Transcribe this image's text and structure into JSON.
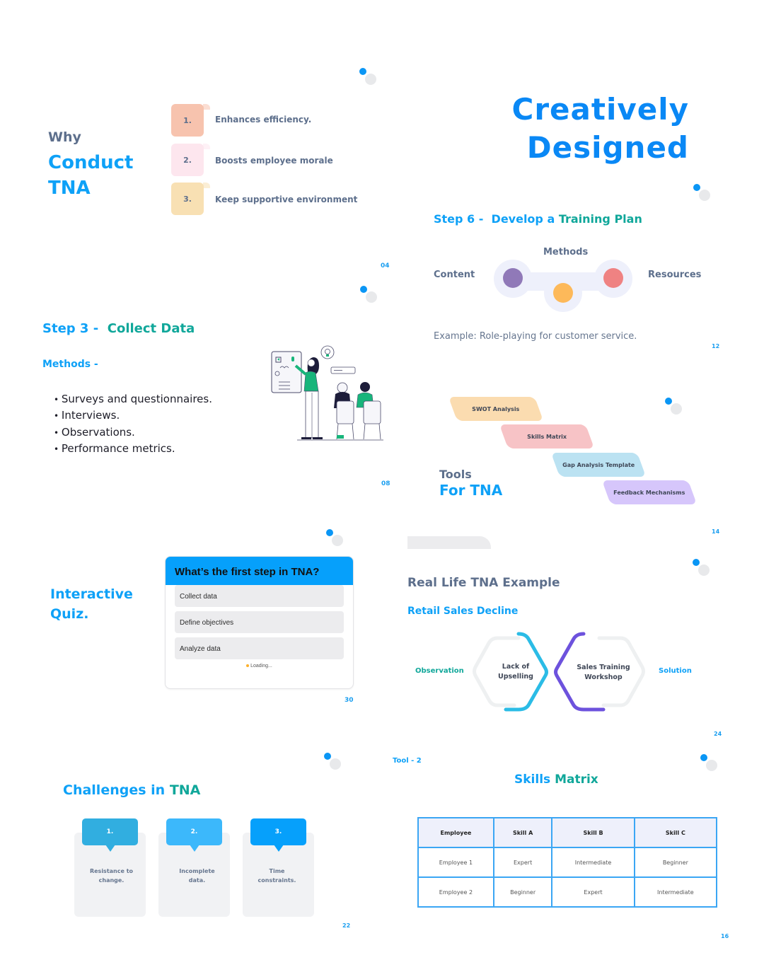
{
  "slides": {
    "why_conduct": {
      "title_line1": "Why",
      "title_line2": "Conduct",
      "title_line3": "TNA",
      "items": [
        {
          "num": "1.",
          "text": "Enhances efficiency.",
          "color": "#f7c3ae"
        },
        {
          "num": "2.",
          "text": "Boosts employee morale",
          "color": "#fde6ee"
        },
        {
          "num": "3.",
          "text": "Keep supportive environment",
          "color": "#f8e0b3"
        }
      ],
      "page": "04"
    },
    "creative": {
      "line1": "Creatively",
      "line2": "Designed"
    },
    "step6": {
      "prefix": "Step 6 -",
      "title_a": "Develop a",
      "title_b": "Training Plan",
      "labels": {
        "content": "Content",
        "methods": "Methods",
        "resources": "Resources"
      },
      "dot_colors": {
        "content": "#9079b8",
        "methods": "#fdb95a",
        "resources": "#ef8282"
      },
      "example": "Example: Role-playing for customer service.",
      "page": "12"
    },
    "step3": {
      "prefix": "Step 3 -",
      "title": "Collect Data",
      "methods_label": "Methods -",
      "methods": [
        "Surveys and questionnaires.",
        "Interviews.",
        "Observations.",
        "Performance metrics."
      ],
      "page": "08"
    },
    "tools": {
      "title_line1": "Tools",
      "title_line2": "For TNA",
      "items": [
        {
          "label": "SWOT Analysis",
          "color": "#fbdcb0"
        },
        {
          "label": "Skills Matrix",
          "color": "#f7c3c6"
        },
        {
          "label": "Gap Analysis Template",
          "color": "#bbe2f2"
        },
        {
          "label": "Feedback Mechanisms",
          "color": "#d6c6fb"
        }
      ],
      "page": "14"
    },
    "quiz": {
      "title_line1": "Interactive",
      "title_line2": "Quiz.",
      "question": "What’s the first step in TNA?",
      "options": [
        "Collect data",
        "Define objectives",
        "Analyze data"
      ],
      "status": "Loading...",
      "page": "30"
    },
    "real_life": {
      "title": "Real Life TNA Example",
      "subtitle": "Retail Sales Decline",
      "left_label": "Observation",
      "right_label": "Solution",
      "left_center_line1": "Lack of",
      "left_center_line2": "Upselling",
      "right_center_line1": "Sales Training",
      "right_center_line2": "Workshop",
      "page": "24"
    },
    "challenges": {
      "title_a": "Challenges in",
      "title_b": "TNA",
      "items": [
        {
          "num": "1.",
          "line1": "Resistance to",
          "line2": "change.",
          "color": "#31aee0"
        },
        {
          "num": "2.",
          "line1": "Incomplete",
          "line2": "data.",
          "color": "#3cb8fb"
        },
        {
          "num": "3.",
          "line1": "Time",
          "line2": "constraints.",
          "color": "#06a0fb"
        }
      ],
      "page": "22"
    },
    "skills_matrix": {
      "tag": "Tool - 2",
      "title_a": "Skills",
      "title_b": "Matrix",
      "headers": [
        "Employee",
        "Skill A",
        "Skill B",
        "Skill C"
      ],
      "rows": [
        [
          "Employee 1",
          "Expert",
          "Intermediate",
          "Beginner"
        ],
        [
          "Employee 2",
          "Beginner",
          "Expert",
          "Intermediate"
        ]
      ],
      "page": "16"
    }
  }
}
